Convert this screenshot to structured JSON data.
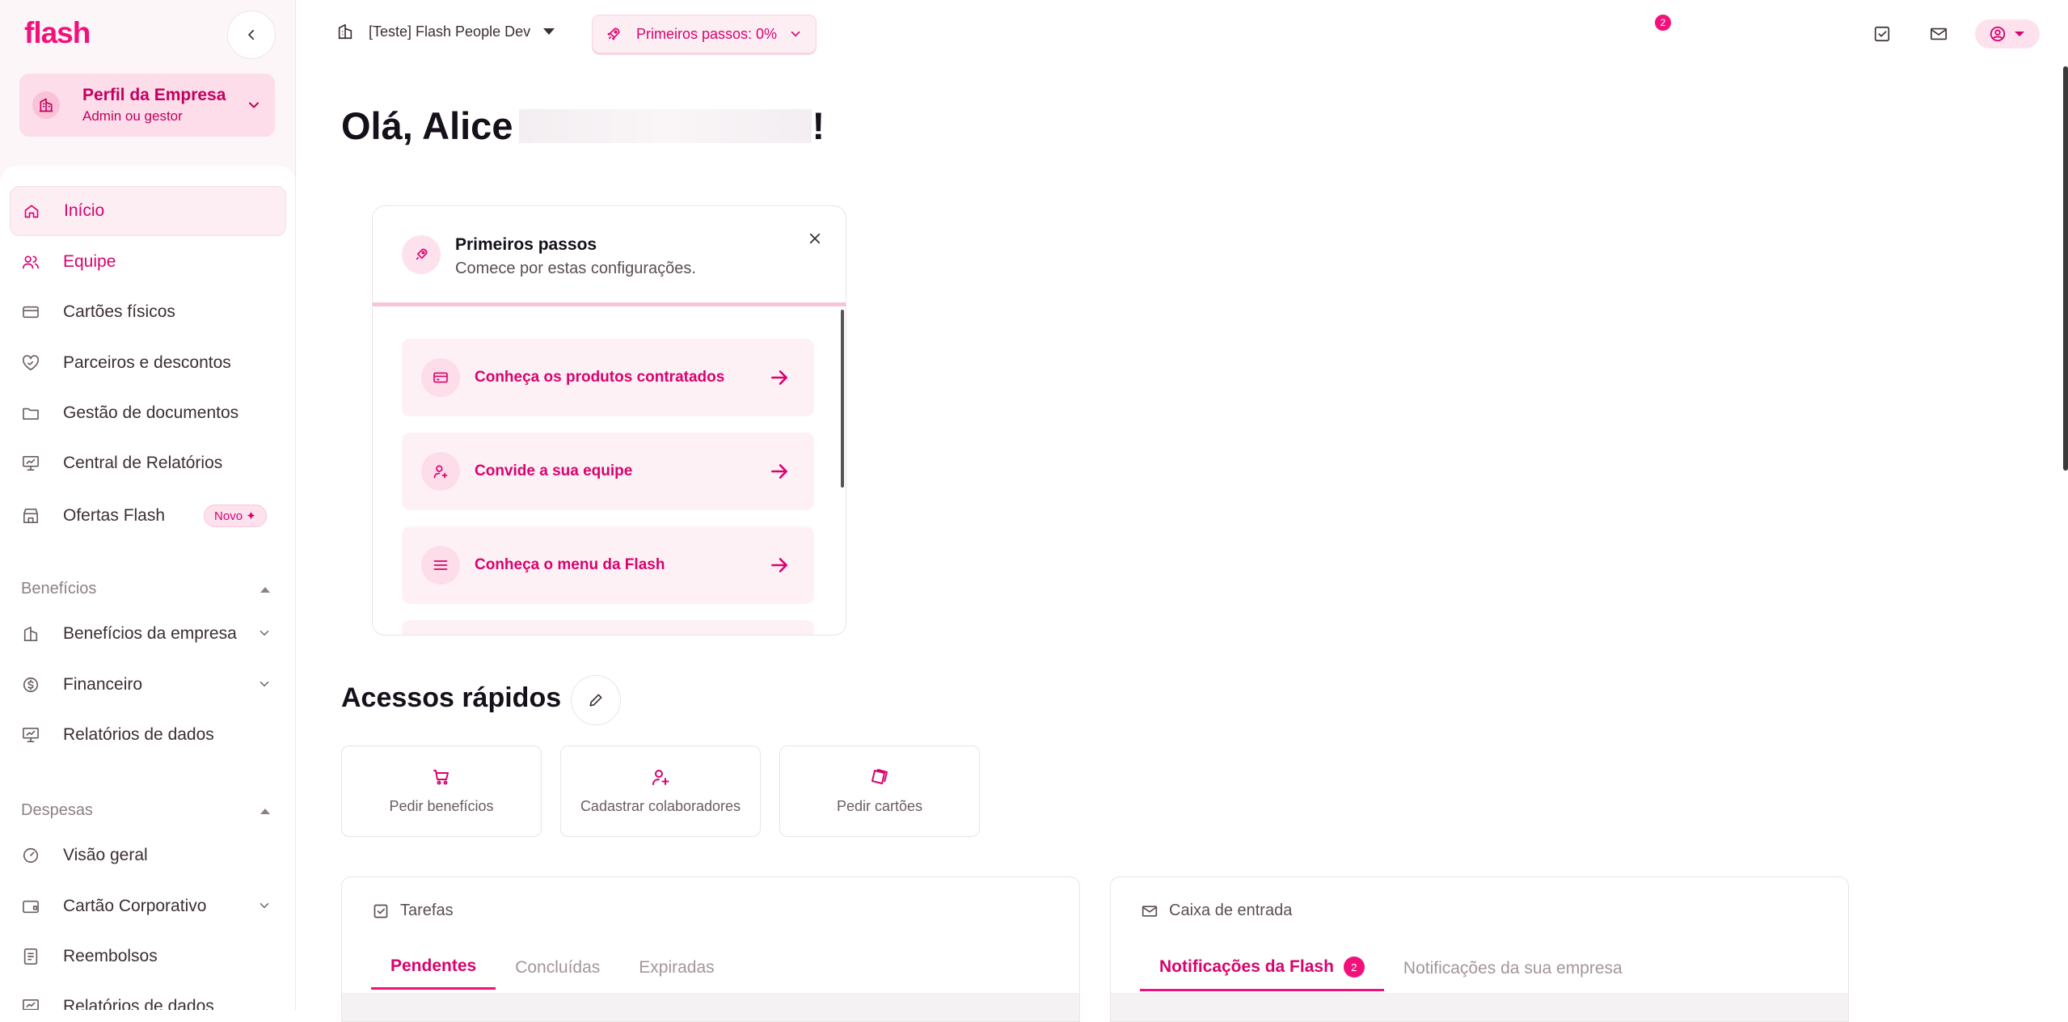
{
  "sidebar": {
    "logo": "flash",
    "profile": {
      "title": "Perfil da Empresa",
      "subtitle": "Admin ou gestor"
    },
    "items": [
      {
        "label": "Início"
      },
      {
        "label": "Equipe"
      },
      {
        "label": "Cartões físicos"
      },
      {
        "label": "Parceiros e descontos"
      },
      {
        "label": "Gestão de documentos"
      },
      {
        "label": "Central de Relatórios"
      },
      {
        "label": "Ofertas Flash",
        "badge": "Novo ✦"
      }
    ],
    "sections": [
      {
        "title": "Benefícios",
        "items": [
          {
            "label": "Benefícios da empresa"
          },
          {
            "label": "Financeiro"
          },
          {
            "label": "Relatórios de dados"
          }
        ]
      },
      {
        "title": "Despesas",
        "items": [
          {
            "label": "Visão geral"
          },
          {
            "label": "Cartão Corporativo"
          },
          {
            "label": "Reembolsos"
          },
          {
            "label": "Relatórios de dados"
          }
        ]
      }
    ]
  },
  "topbar": {
    "company": "[Teste] Flash People Dev",
    "progress": "Primeiros passos: 0%",
    "progress_value": 0,
    "mail_badge": "2"
  },
  "main": {
    "greeting": "Olá, Alice",
    "greeting_end": "!",
    "first_steps": {
      "title": "Primeiros passos",
      "subtitle": "Comece por estas configurações.",
      "steps": [
        {
          "label": "Conheça os produtos contratados"
        },
        {
          "label": "Convide a sua equipe"
        },
        {
          "label": "Conheça o menu da Flash"
        }
      ]
    },
    "quick_access": {
      "title": "Acessos rápidos",
      "items": [
        {
          "label": "Pedir benefícios",
          "icon": "cart-icon"
        },
        {
          "label": "Cadastrar colaboradores",
          "icon": "user-plus-icon"
        },
        {
          "label": "Pedir cartões",
          "icon": "cards-icon"
        }
      ]
    },
    "tasks": {
      "title": "Tarefas",
      "tabs": [
        "Pendentes",
        "Concluídas",
        "Expiradas"
      ]
    },
    "inbox": {
      "title": "Caixa de entrada",
      "tabs": [
        "Notificações da Flash",
        "Notificações da sua empresa"
      ],
      "badge": "2"
    }
  },
  "colors": {
    "accent": "#f2117a",
    "accent_dark": "#d8036e",
    "accent_soft": "#fde2ee"
  }
}
